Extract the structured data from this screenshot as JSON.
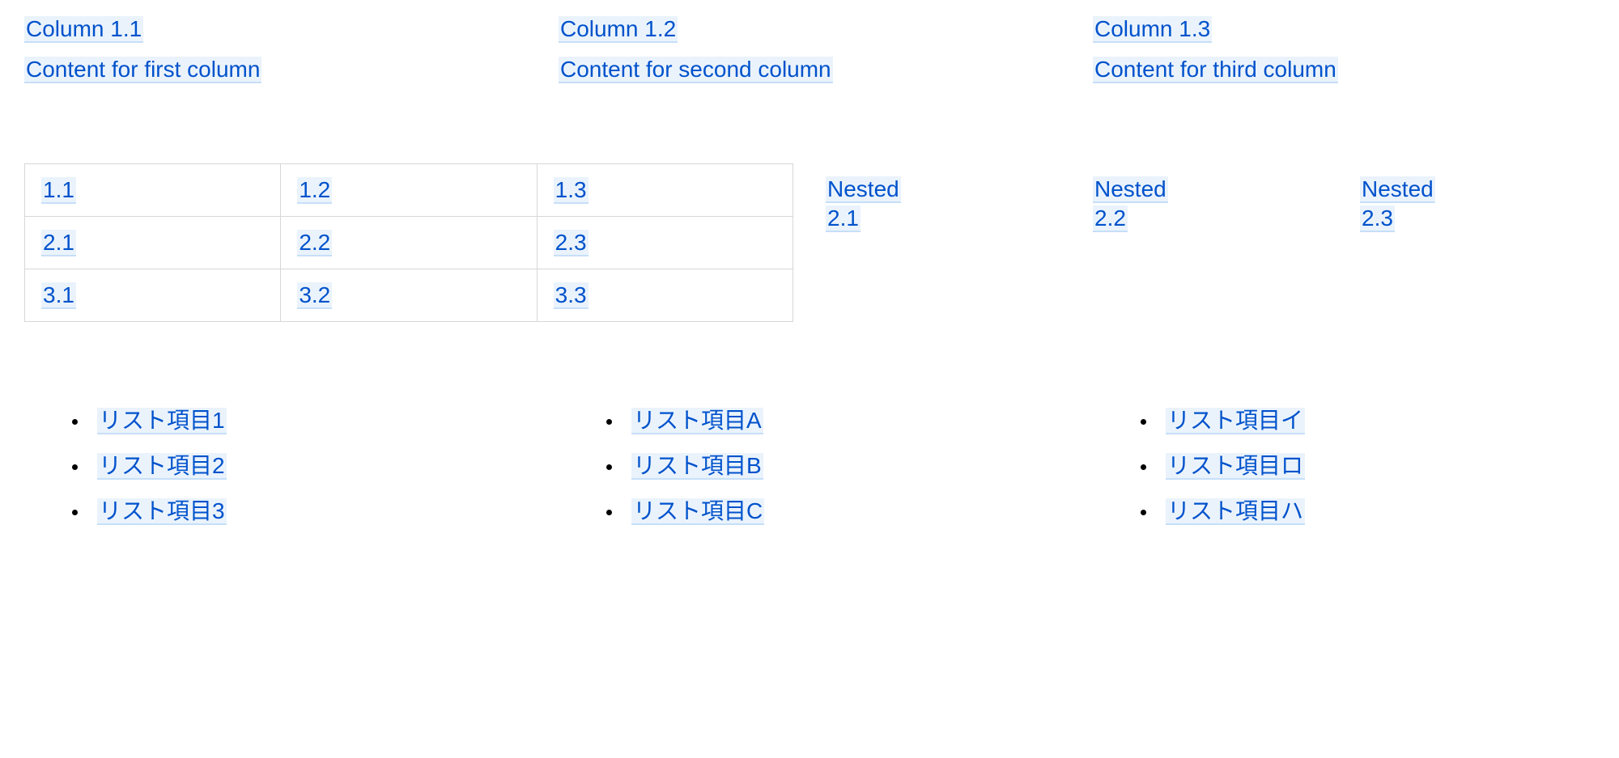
{
  "section1": {
    "columns": [
      {
        "header": "Column 1.1",
        "content": "Content for first column"
      },
      {
        "header": "Column 1.2",
        "content": "Content for second column"
      },
      {
        "header": "Column 1.3",
        "content": "Content for third column"
      }
    ]
  },
  "section2": {
    "table": {
      "rows": [
        [
          "1.1",
          "1.2",
          "1.3"
        ],
        [
          "2.1",
          "2.2",
          "2.3"
        ],
        [
          "3.1",
          "3.2",
          "3.3"
        ]
      ]
    },
    "nested": [
      {
        "line1": "Nested",
        "line2": "2.1"
      },
      {
        "line1": "Nested",
        "line2": "2.2"
      },
      {
        "line1": "Nested",
        "line2": "2.3"
      }
    ]
  },
  "section3": {
    "lists": [
      [
        "リスト項目1",
        "リスト項目2",
        "リスト項目3"
      ],
      [
        "リスト項目A",
        "リスト項目B",
        "リスト項目C"
      ],
      [
        "リスト項目イ",
        "リスト項目ロ",
        "リスト項目ハ"
      ]
    ]
  }
}
